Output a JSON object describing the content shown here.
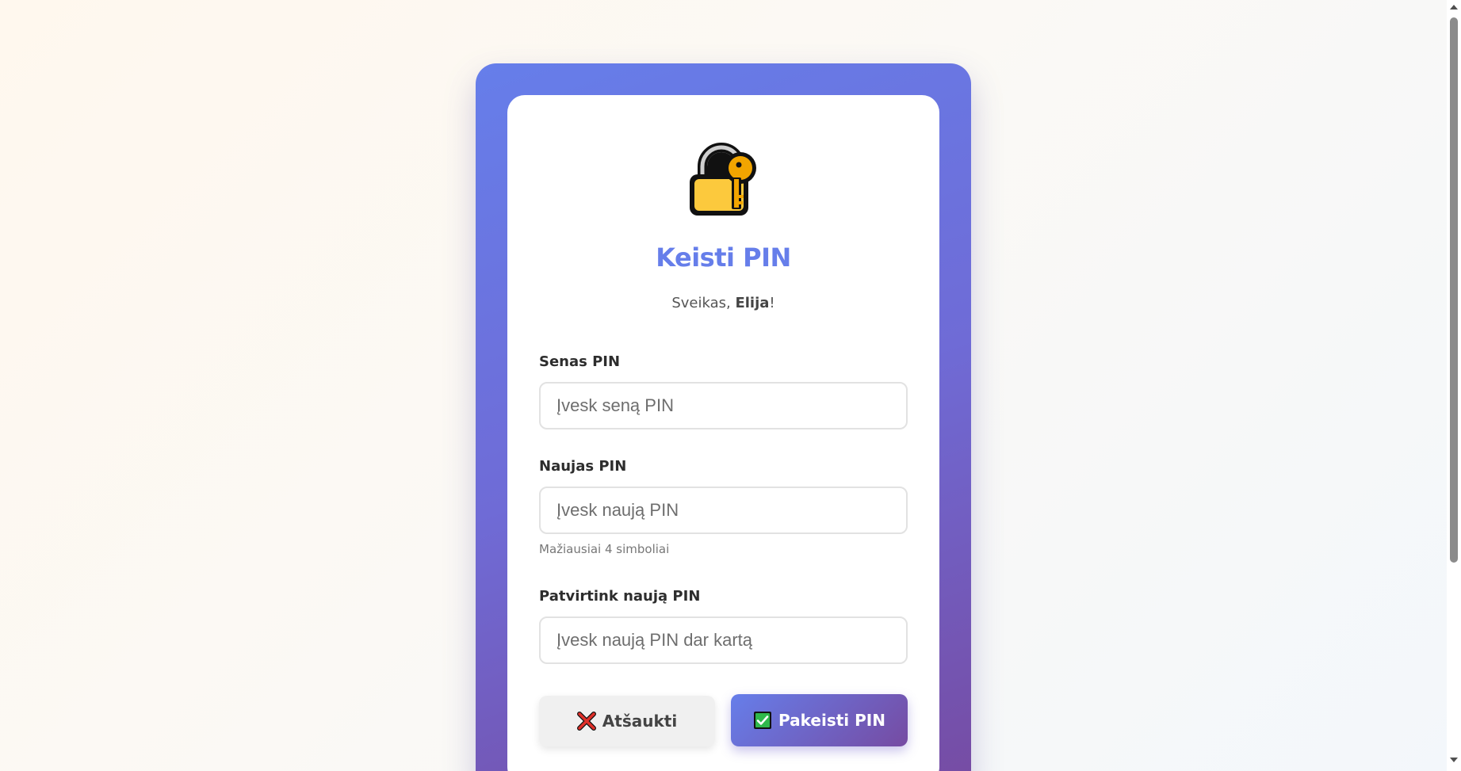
{
  "page": {
    "title": "Keisti PIN",
    "greeting_prefix": "Sveikas, ",
    "user_name": "Elija",
    "greeting_suffix": "!"
  },
  "form": {
    "old_pin": {
      "label": "Senas PIN",
      "placeholder": "Įvesk seną PIN",
      "value": ""
    },
    "new_pin": {
      "label": "Naujas PIN",
      "placeholder": "Įvesk naują PIN",
      "value": "",
      "hint": "Mažiausiai 4 simboliai"
    },
    "confirm_pin": {
      "label": "Patvirtink naują PIN",
      "placeholder": "Įvesk naują PIN dar kartą",
      "value": ""
    }
  },
  "buttons": {
    "cancel_label": "Atšaukti",
    "cancel_icon": "cross-mark-icon",
    "submit_label": "Pakeisti PIN",
    "submit_icon": "check-mark-icon"
  },
  "icons": {
    "header": "lock-with-key-icon"
  },
  "colors": {
    "accent_start": "#667eea",
    "accent_end": "#764ba2",
    "title": "#667eea"
  }
}
